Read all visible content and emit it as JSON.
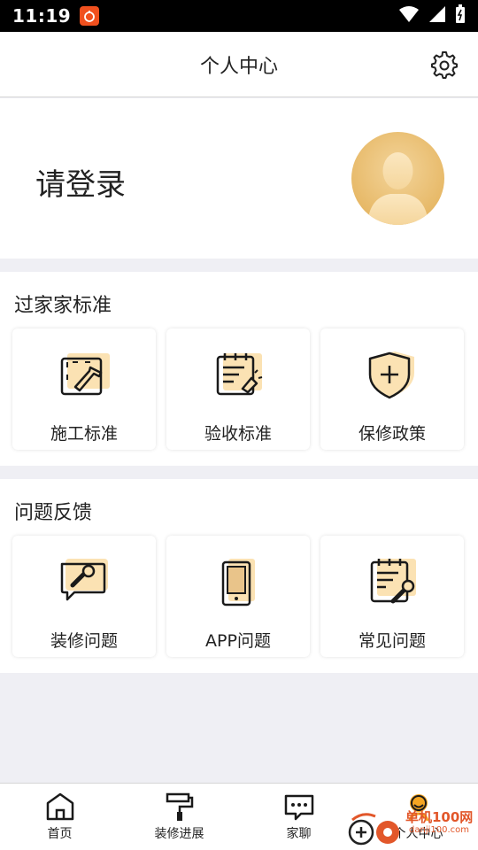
{
  "status_bar": {
    "time": "11:19"
  },
  "nav": {
    "title": "个人中心"
  },
  "profile": {
    "login_prompt": "请登录"
  },
  "standards": {
    "title": "过家家标准",
    "items": [
      {
        "label": "施工标准",
        "icon": "construction-icon"
      },
      {
        "label": "验收标准",
        "icon": "inspection-icon"
      },
      {
        "label": "保修政策",
        "icon": "warranty-shield-icon"
      }
    ]
  },
  "feedback": {
    "title": "问题反馈",
    "items": [
      {
        "label": "装修问题",
        "icon": "wrench-chat-icon"
      },
      {
        "label": "APP问题",
        "icon": "tablet-icon"
      },
      {
        "label": "常见问题",
        "icon": "faq-wrench-icon"
      }
    ]
  },
  "tabs": [
    {
      "label": "首页",
      "icon": "home-icon"
    },
    {
      "label": "装修进展",
      "icon": "paint-roller-icon"
    },
    {
      "label": "家聊",
      "icon": "chat-icon"
    },
    {
      "label": "个人中心",
      "icon": "user-icon"
    }
  ],
  "watermark": {
    "line1": "单机100网",
    "line2": "danji100.com"
  },
  "colors": {
    "accent": "#f5a623",
    "icon_fill": "#fbe2b3",
    "icon_stroke": "#1a1a1a",
    "page_bg": "#efeff4"
  }
}
